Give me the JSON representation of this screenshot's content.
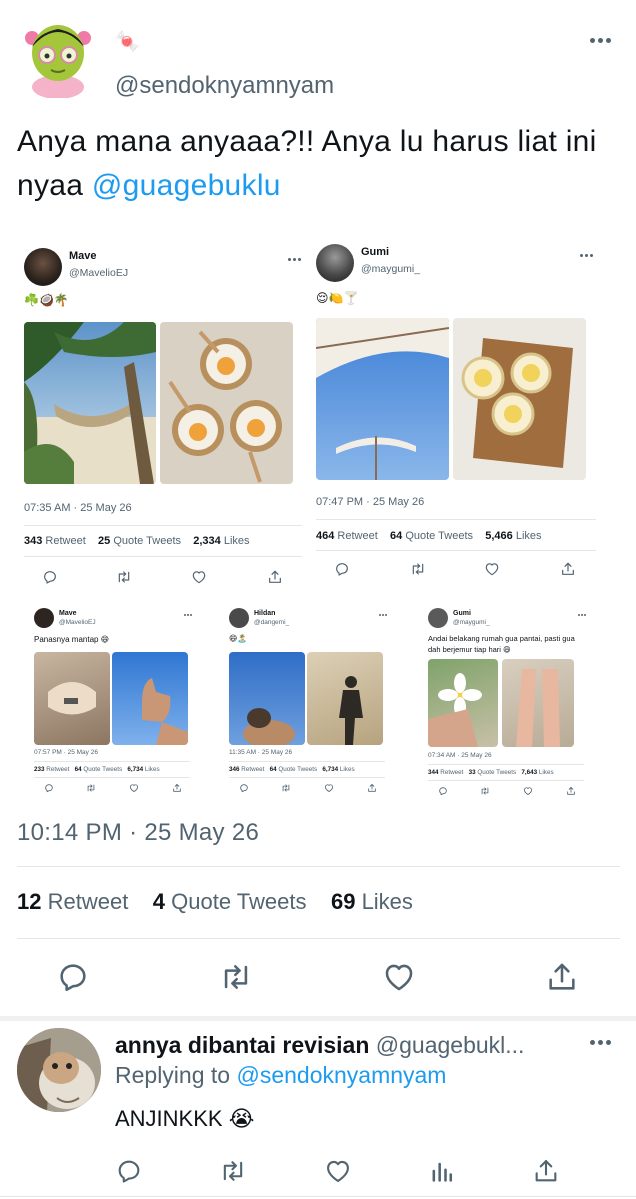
{
  "main_tweet": {
    "emoji": "🍬",
    "handle": "@sendoknyamnyam",
    "text_before": "Anya mana anyaaa?!! Anya lu harus liat ini nyaa ",
    "mention": "@guagebuklu",
    "timestamp": "10:14 PM · 25 May 26",
    "retweets": "12",
    "retweet_label": "Retweet",
    "quotes": "4",
    "quote_label": "Quote Tweets",
    "likes": "69",
    "like_label": "Likes"
  },
  "embedded": {
    "mave": {
      "name": "Mave",
      "handle": "@MavelioEJ",
      "text": "☘️🥥🌴",
      "time": "07:35 AM · 25 May 26",
      "retweets": "343",
      "retweet_label": "Retweet",
      "quotes": "25",
      "quote_label": "Quote Tweets",
      "likes": "2,334",
      "like_label": "Likes"
    },
    "gumi": {
      "name": "Gumi",
      "handle": "@maygumi_",
      "text": "😌🍋🍸",
      "time": "07:47 PM · 25 May 26",
      "retweets": "464",
      "retweet_label": "Retweet",
      "quotes": "64",
      "quote_label": "Quote Tweets",
      "likes": "5,466",
      "like_label": "Likes"
    },
    "small_mave": {
      "name": "Mave",
      "handle": "@MavelioEJ",
      "text": "Panasnya mantap 😄",
      "time": "07:57 PM · 25 May 26",
      "retweets": "233",
      "retweet_label": "Retweet",
      "quotes": "64",
      "quote_label": "Quote Tweets",
      "likes": "6,734",
      "like_label": "Likes"
    },
    "small_hildan": {
      "name": "Hildan",
      "handle": "@dangemi_",
      "text": "😄🏝️",
      "time": "11:35 AM · 25 May 26",
      "retweets": "346",
      "retweet_label": "Retweet",
      "quotes": "64",
      "quote_label": "Quote Tweets",
      "likes": "6,734",
      "like_label": "Likes"
    },
    "small_gumi": {
      "name": "Gumi",
      "handle": "@maygumi_",
      "text": "Andai belakang rumah gua pantai, pasti gua dah berjemur tiap hari 😄",
      "time": "07:34 AM · 25 May 26",
      "retweets": "344",
      "retweet_label": "Retweet",
      "quotes": "33",
      "quote_label": "Quote Tweets",
      "likes": "7,643",
      "like_label": "Likes"
    }
  },
  "reply": {
    "name": "annya dibantai revisian",
    "handle": "@guagebukl...",
    "replying_prefix": "Replying to ",
    "replying_to": "@sendoknyamnyam",
    "text": "ANJINKKK 😭"
  },
  "icons": [
    "reply-icon",
    "retweet-icon",
    "like-icon",
    "share-icon",
    "analytics-icon",
    "more-icon"
  ],
  "colors": {
    "accent": "#1d9bf0",
    "text": "#0f1419",
    "secondary": "#536471"
  }
}
